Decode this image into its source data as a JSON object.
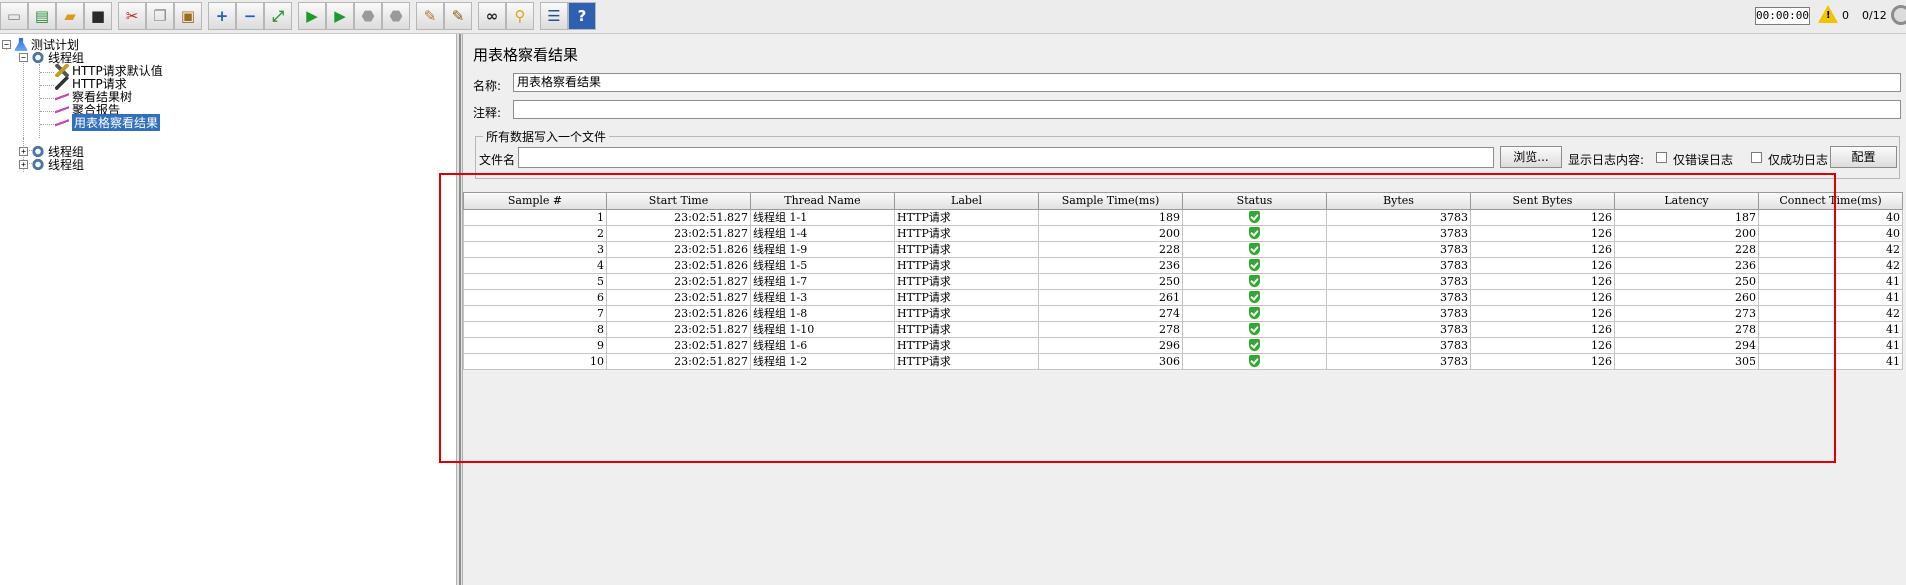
{
  "toolbar": {
    "buttons": [
      {
        "name": "new",
        "icon": "new-file-icon",
        "glyph": "▭",
        "color": "#8a8a8a"
      },
      {
        "name": "templates",
        "icon": "templates-icon",
        "glyph": "▤",
        "color": "#2f8f3b"
      },
      {
        "name": "open",
        "icon": "folder-open-icon",
        "glyph": "▰",
        "color": "#d99a1e"
      },
      {
        "name": "save",
        "icon": "save-icon",
        "glyph": "■",
        "color": "#2a2a2a"
      },
      {
        "name": "cut",
        "icon": "cut-icon",
        "glyph": "✂",
        "color": "#c21f1f"
      },
      {
        "name": "copy",
        "icon": "copy-icon",
        "glyph": "❐",
        "color": "#8a8a8a"
      },
      {
        "name": "paste",
        "icon": "paste-icon",
        "glyph": "▣",
        "color": "#9c6b1e"
      },
      {
        "name": "expand",
        "icon": "plus-icon",
        "glyph": "+",
        "color": "#1f5fbf"
      },
      {
        "name": "collapse",
        "icon": "minus-icon",
        "glyph": "−",
        "color": "#1f5fbf"
      },
      {
        "name": "toggle",
        "icon": "toggle-icon",
        "glyph": "⤢",
        "color": "#2f8f3b"
      },
      {
        "name": "start",
        "icon": "play-icon",
        "glyph": "▶",
        "color": "#1d9a2b"
      },
      {
        "name": "start-no-pauses",
        "icon": "play-no-pause-icon",
        "glyph": "▶",
        "color": "#1d9a2b"
      },
      {
        "name": "stop",
        "icon": "stop-icon",
        "glyph": "⬣",
        "color": "#9a9a9a"
      },
      {
        "name": "shutdown",
        "icon": "shutdown-icon",
        "glyph": "⬣",
        "color": "#9a9a9a"
      },
      {
        "name": "clear",
        "icon": "clear-icon",
        "glyph": "✎",
        "color": "#b07a2a"
      },
      {
        "name": "clear-all",
        "icon": "clear-all-icon",
        "glyph": "✎",
        "color": "#8a5a1a"
      },
      {
        "name": "search",
        "icon": "binoculars-icon",
        "glyph": "∞",
        "color": "#222"
      },
      {
        "name": "reset-search",
        "icon": "broom-icon",
        "glyph": "⚲",
        "color": "#d8a51b"
      },
      {
        "name": "function-helper",
        "icon": "list-icon",
        "glyph": "☰",
        "color": "#2a4f8f"
      },
      {
        "name": "help",
        "icon": "help-icon",
        "glyph": "?",
        "color": "#ffffff"
      }
    ],
    "timer": "00:00:00",
    "warning_icon": "warning-icon",
    "warning_mark": "!",
    "warning_count": "0",
    "threads": "0/12"
  },
  "tree": {
    "root": "测试计划",
    "group1": "线程组",
    "children": [
      "HTTP请求默认值",
      "HTTP请求",
      "察看结果树",
      "聚合报告",
      "用表格察看结果"
    ],
    "group2": "线程组",
    "group3": "线程组"
  },
  "panel": {
    "title": "用表格察看结果",
    "name_label": "名称:",
    "name_value": "用表格察看结果",
    "comment_label": "注释:",
    "comment_value": "",
    "file_section_title": "所有数据写入一个文件",
    "filename_label": "文件名",
    "filename_value": "",
    "browse_button": "浏览...",
    "log_label": "显示日志内容:",
    "errors_only": "仅错误日志",
    "success_only": "仅成功日志",
    "configure_button": "配置"
  },
  "table": {
    "columns": [
      "Sample #",
      "Start Time",
      "Thread Name",
      "Label",
      "Sample Time(ms)",
      "Status",
      "Bytes",
      "Sent Bytes",
      "Latency",
      "Connect Time(ms)"
    ],
    "rows": [
      [
        "1",
        "23:02:51.827",
        "线程组 1-1",
        "HTTP请求",
        "189",
        "success",
        "3783",
        "126",
        "187",
        "40"
      ],
      [
        "2",
        "23:02:51.827",
        "线程组 1-4",
        "HTTP请求",
        "200",
        "success",
        "3783",
        "126",
        "200",
        "40"
      ],
      [
        "3",
        "23:02:51.826",
        "线程组 1-9",
        "HTTP请求",
        "228",
        "success",
        "3783",
        "126",
        "228",
        "42"
      ],
      [
        "4",
        "23:02:51.826",
        "线程组 1-5",
        "HTTP请求",
        "236",
        "success",
        "3783",
        "126",
        "236",
        "42"
      ],
      [
        "5",
        "23:02:51.827",
        "线程组 1-7",
        "HTTP请求",
        "250",
        "success",
        "3783",
        "126",
        "250",
        "41"
      ],
      [
        "6",
        "23:02:51.827",
        "线程组 1-3",
        "HTTP请求",
        "261",
        "success",
        "3783",
        "126",
        "260",
        "41"
      ],
      [
        "7",
        "23:02:51.826",
        "线程组 1-8",
        "HTTP请求",
        "274",
        "success",
        "3783",
        "126",
        "273",
        "42"
      ],
      [
        "8",
        "23:02:51.827",
        "线程组 1-10",
        "HTTP请求",
        "278",
        "success",
        "3783",
        "126",
        "278",
        "41"
      ],
      [
        "9",
        "23:02:51.827",
        "线程组 1-6",
        "HTTP请求",
        "296",
        "success",
        "3783",
        "126",
        "294",
        "41"
      ],
      [
        "10",
        "23:02:51.827",
        "线程组 1-2",
        "HTTP请求",
        "306",
        "success",
        "3783",
        "126",
        "305",
        "41"
      ]
    ]
  },
  "colors": {
    "selection": "#2f6fbd",
    "highlight_box": "#e00000",
    "status_success": "#2faa2f"
  }
}
